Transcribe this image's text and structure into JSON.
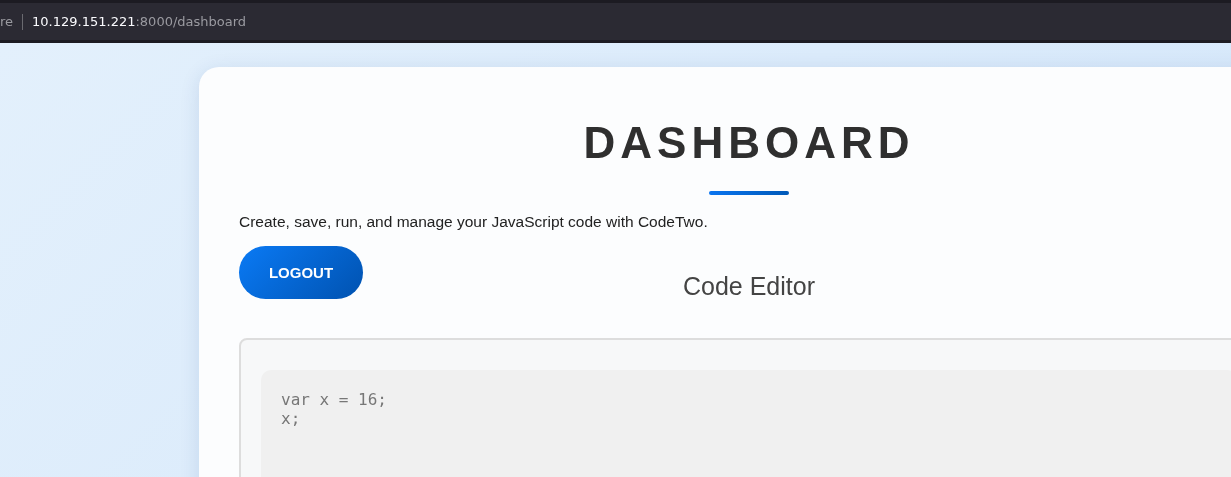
{
  "browser": {
    "security_label": "re",
    "url_host": "10.129.151.221",
    "url_path": ":8000/dashboard"
  },
  "page": {
    "title": "DASHBOARD",
    "description": "Create, save, run, and manage your JavaScript code with CodeTwo.",
    "logout_button": "LOGOUT",
    "editor_heading": "Code Editor",
    "code": "var x = 16;\nx;"
  }
}
